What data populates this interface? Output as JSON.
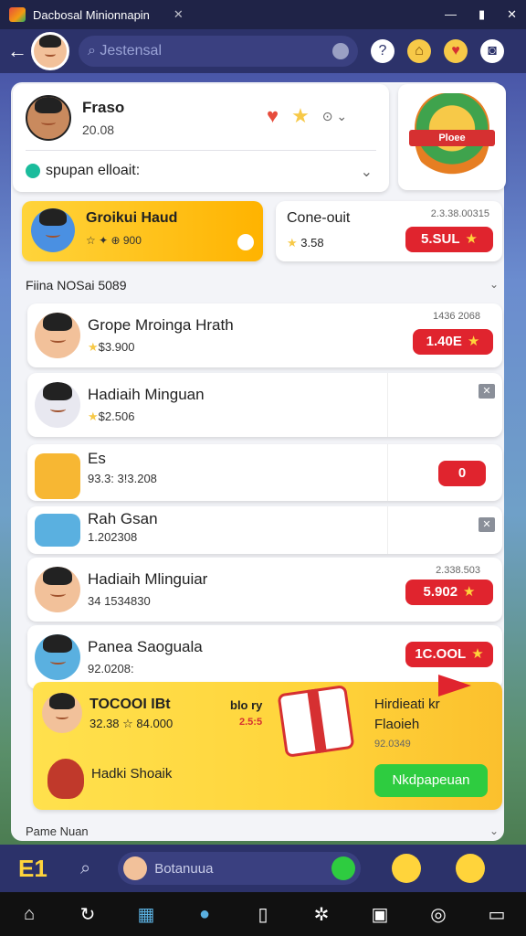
{
  "window": {
    "title": "Dacbosal Minionnapin"
  },
  "topbar": {
    "search_placeholder": "Jestensal"
  },
  "profile": {
    "name": "Fraso",
    "points": "20.08",
    "status": "spupan elloait:"
  },
  "badge": {
    "ribbon": "Ploee"
  },
  "promo_left": {
    "title": "Groikui Haud",
    "sub": "☆ ✦ ⊕ 900"
  },
  "promo_right": {
    "title": "Cone-ouit",
    "sub": "3.58",
    "num": "2.3.38.00315",
    "button": "5.SUL"
  },
  "section": {
    "title": "Fiina NOSai 5089"
  },
  "rows": [
    {
      "title": "Grope Mroinga Hrath",
      "sub": "$3.900",
      "num": "1436 2068",
      "button": "1.40E"
    },
    {
      "title": "Hadiaih Minguan",
      "sub": "$2.506",
      "num": "",
      "button": ""
    },
    {
      "title": "Es",
      "sub": "93.3: 3!3.208",
      "num": "",
      "button": "0"
    },
    {
      "title": "Rah Gsan",
      "sub": "1.202308",
      "num": "",
      "button": ""
    },
    {
      "title": "Hadiaih Mlinguiar",
      "sub": "34 1534830",
      "num": "2.338.503",
      "button": "5.902"
    },
    {
      "title": "Panea Saoguala",
      "sub": "92.0208:",
      "num": "",
      "button": "1C.OOL"
    }
  ],
  "feature": {
    "title": "TOCOOI IBt",
    "sub": "32.38 ☆ 84.000",
    "mid1": "blo ry",
    "mid2": "2.5:5",
    "r1": "Hirdieati kr",
    "r2": "Flaoieh",
    "r3": "92.0349",
    "bottom": "Hadki Shoaik",
    "green": "Nkdpapeuan"
  },
  "footer": {
    "title": "Pame Nuan"
  },
  "bottombar": {
    "logo": "E1",
    "message_placeholder": "Botanuua"
  }
}
